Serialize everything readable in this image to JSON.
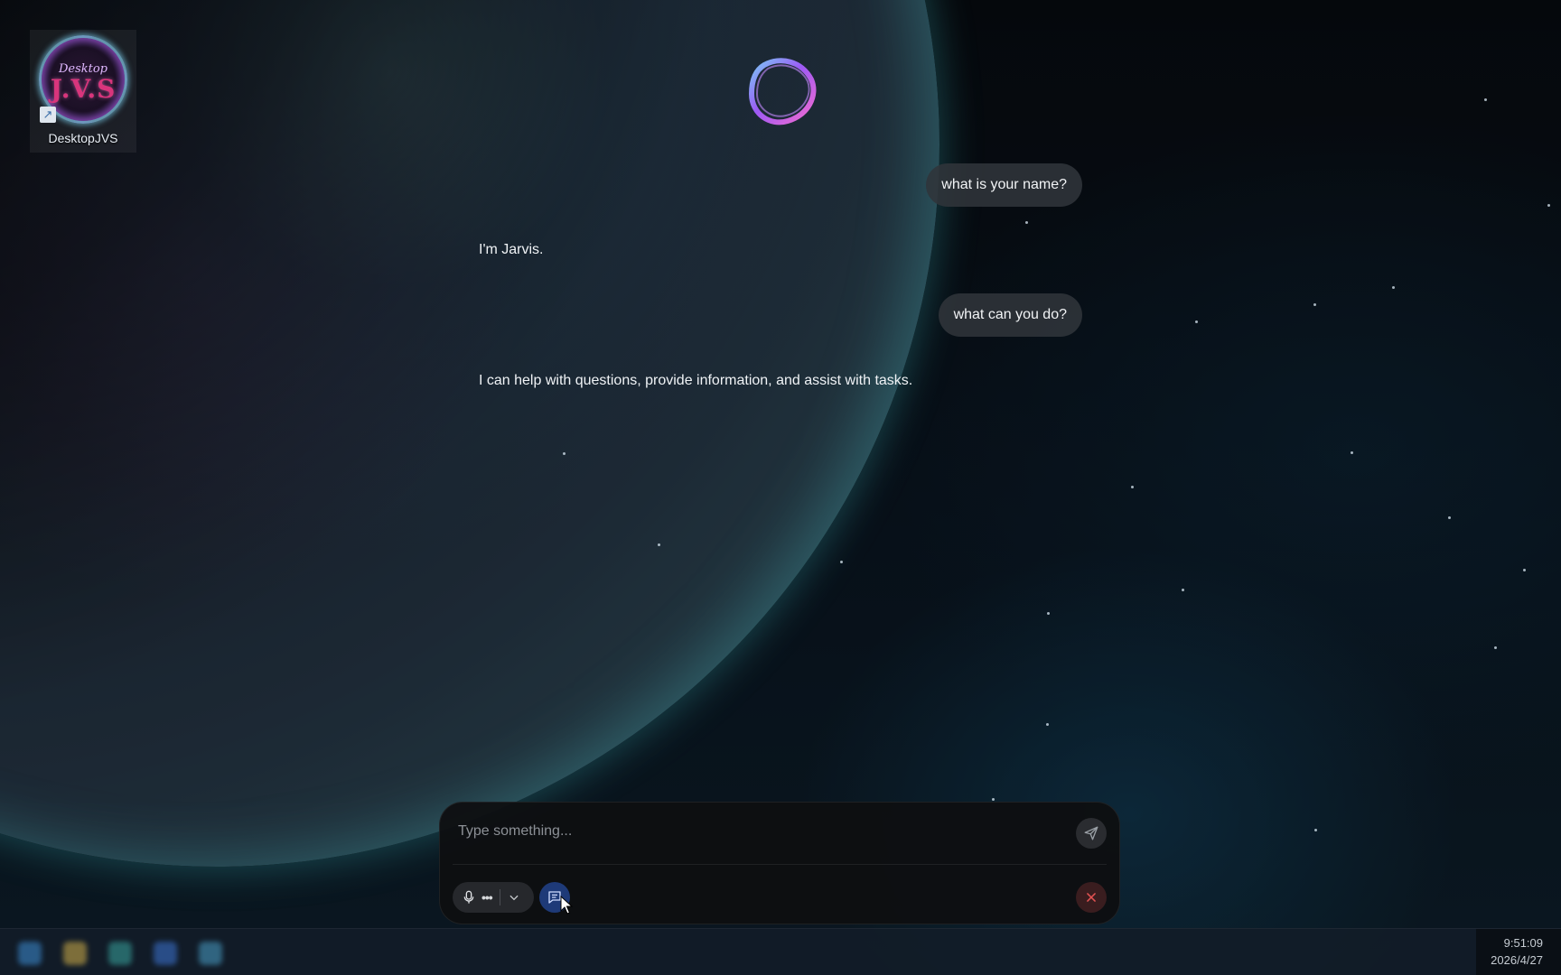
{
  "desktop": {
    "shortcut": {
      "label": "DesktopJVS",
      "logo_top_text": "Desktop",
      "logo_main_text": "J.V.S",
      "icon": "shortcut-arrow-icon"
    }
  },
  "assistant": {
    "orb_icon": "assistant-orb-icon",
    "messages": [
      {
        "role": "user",
        "text": "what is your name?"
      },
      {
        "role": "assistant",
        "text": "I'm Jarvis."
      },
      {
        "role": "user",
        "text": "what can you do?"
      },
      {
        "role": "assistant",
        "text": "I can help with questions, provide information, and assist with tasks."
      }
    ]
  },
  "composer": {
    "placeholder": "Type something...",
    "value": "",
    "send_icon": "send-icon",
    "mic_icon": "microphone-icon",
    "more_icon": "more-dots-icon",
    "chevron_icon": "chevron-down-icon",
    "chat_icon": "chat-bubble-icon",
    "close_icon": "close-icon"
  },
  "taskbar": {
    "time": "9:51:09",
    "date": "2026/4/27"
  },
  "colors": {
    "chat_toggle_active": "#1e3a78",
    "close_accent": "#e25252",
    "planet_rim": "#62c7cf"
  }
}
